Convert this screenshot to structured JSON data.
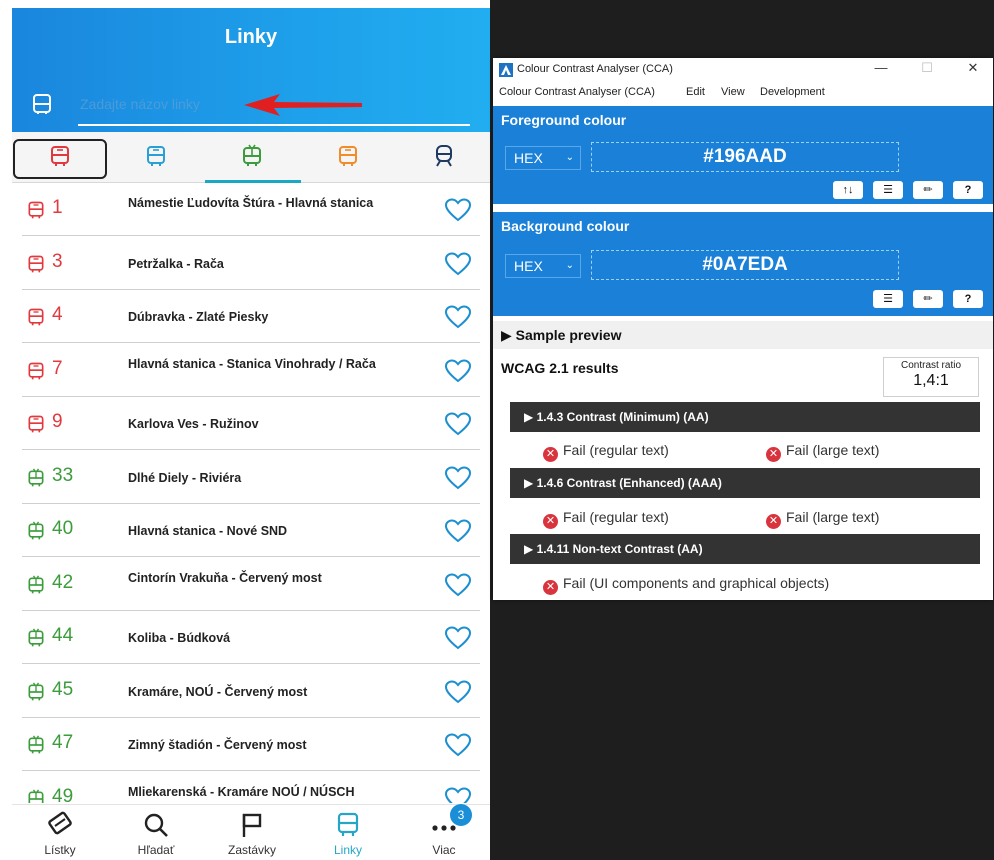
{
  "app": {
    "title": "Linky",
    "search_placeholder": "Zadajte názov linky",
    "tabs": [
      {
        "name": "bus-red",
        "color": "#e0393e"
      },
      {
        "name": "bus-blue",
        "color": "#2a9fd6"
      },
      {
        "name": "trolleybus-green",
        "color": "#3c9c3c"
      },
      {
        "name": "bus-orange",
        "color": "#f08c2a"
      },
      {
        "name": "train-navy",
        "color": "#1f3a63"
      }
    ],
    "lines": [
      {
        "num": "1",
        "name": "Námestie Ľudovíta Štúra - Hlavná stanica",
        "color": "#e0393e",
        "kind": "tram"
      },
      {
        "num": "3",
        "name": "Petržalka - Rača",
        "color": "#e0393e",
        "kind": "tram"
      },
      {
        "num": "4",
        "name": "Dúbravka - Zlaté Piesky",
        "color": "#e0393e",
        "kind": "tram"
      },
      {
        "num": "7",
        "name": "Hlavná stanica - Stanica Vinohrady / Rača",
        "color": "#e0393e",
        "kind": "tram"
      },
      {
        "num": "9",
        "name": "Karlova Ves - Ružinov",
        "color": "#e0393e",
        "kind": "tram"
      },
      {
        "num": "33",
        "name": "Dlhé Diely - Riviéra",
        "color": "#3c9c3c",
        "kind": "trolley"
      },
      {
        "num": "40",
        "name": "Hlavná stanica - Nové SND",
        "color": "#3c9c3c",
        "kind": "trolley"
      },
      {
        "num": "42",
        "name": "Cintorín Vrakuňa - Červený most",
        "color": "#3c9c3c",
        "kind": "trolley"
      },
      {
        "num": "44",
        "name": "Koliba - Búdková",
        "color": "#3c9c3c",
        "kind": "trolley"
      },
      {
        "num": "45",
        "name": "Kramáre, NOÚ - Červený most",
        "color": "#3c9c3c",
        "kind": "trolley"
      },
      {
        "num": "47",
        "name": "Zimný štadión - Červený most",
        "color": "#3c9c3c",
        "kind": "trolley"
      },
      {
        "num": "49",
        "name": "Mliekarenská - Kramáre NOÚ / NÚSCH",
        "color": "#3c9c3c",
        "kind": "trolley"
      }
    ],
    "nav": [
      {
        "label": "Lístky",
        "icon": "ticket-icon"
      },
      {
        "label": "Hľadať",
        "icon": "search-icon"
      },
      {
        "label": "Zastávky",
        "icon": "flag-icon"
      },
      {
        "label": "Linky",
        "icon": "bus-icon"
      },
      {
        "label": "Viac",
        "icon": "more-icon"
      }
    ],
    "badge": "3",
    "accent": "#1a86dd"
  },
  "cca": {
    "window_title": "Colour Contrast Analyser (CCA)",
    "controls": {
      "minimize": "—",
      "maximize": "☐",
      "close": "✕"
    },
    "menu": [
      "Colour Contrast Analyser (CCA)",
      "Edit",
      "View",
      "Development"
    ],
    "foreground": {
      "title": "Foreground colour",
      "format": "HEX",
      "value": "#196AAD"
    },
    "background": {
      "title": "Background colour",
      "format": "HEX",
      "value": "#0A7EDA"
    },
    "sample_preview": "▶  Sample preview",
    "wcag_title": "WCAG 2.1 results",
    "ratio_label": "Contrast ratio",
    "ratio_value": "1,4:1",
    "criteria": [
      {
        "label": "▶  1.4.3 Contrast (Minimum) (AA)",
        "results": [
          "Fail (regular text)",
          "Fail (large text)"
        ]
      },
      {
        "label": "▶  1.4.6 Contrast (Enhanced) (AAA)",
        "results": [
          "Fail (regular text)",
          "Fail (large text)"
        ]
      },
      {
        "label": "▶  1.4.11 Non-text Contrast (AA)",
        "results": [
          "Fail (UI components and graphical objects)"
        ]
      }
    ],
    "panel_color": "#1a80d8",
    "fail_color": "#d9343e"
  }
}
